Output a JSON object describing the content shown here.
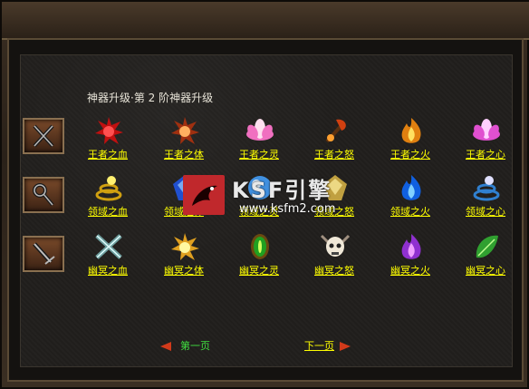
{
  "panel": {
    "title": "神器升级·第 2 阶神器升级"
  },
  "rows": [
    {
      "category_icon": "crossed-daggers-icon",
      "items": [
        {
          "label": "王者之血",
          "icon": "blood-crest-icon"
        },
        {
          "label": "王者之体",
          "icon": "thorn-crown-icon"
        },
        {
          "label": "王者之灵",
          "icon": "lotus-icon"
        },
        {
          "label": "王者之怒",
          "icon": "fire-axe-icon"
        },
        {
          "label": "王者之火",
          "icon": "flame-icon"
        },
        {
          "label": "王者之心",
          "icon": "pink-lotus-icon"
        }
      ]
    },
    {
      "category_icon": "whip-icon",
      "items": [
        {
          "label": "领域之血",
          "icon": "golden-serpent-icon"
        },
        {
          "label": "领域之体",
          "icon": "blue-crystal-icon"
        },
        {
          "label": "领域之灵",
          "icon": "spirit-orb-icon"
        },
        {
          "label": "领域之怒",
          "icon": "rage-mask-icon"
        },
        {
          "label": "领域之火",
          "icon": "blue-flame-icon"
        },
        {
          "label": "领域之心",
          "icon": "blue-dragon-icon"
        }
      ]
    },
    {
      "category_icon": "sword-icon",
      "items": [
        {
          "label": "幽冥之血",
          "icon": "crossed-blades-icon"
        },
        {
          "label": "幽冥之体",
          "icon": "golden-burst-icon"
        },
        {
          "label": "幽冥之灵",
          "icon": "green-eye-icon"
        },
        {
          "label": "幽冥之怒",
          "icon": "horned-skull-icon"
        },
        {
          "label": "幽冥之火",
          "icon": "purple-flame-icon"
        },
        {
          "label": "幽冥之心",
          "icon": "green-leaf-icon"
        }
      ]
    }
  ],
  "pager": {
    "prev_label": "第一页",
    "next_label": "下一页"
  },
  "watermark": {
    "brand": "KSF引擎",
    "url": "www.ksfm2.com"
  },
  "colors": {
    "label_yellow": "#ffff00",
    "prev_green": "#40e040",
    "arrow_red": "#d23a1a"
  }
}
